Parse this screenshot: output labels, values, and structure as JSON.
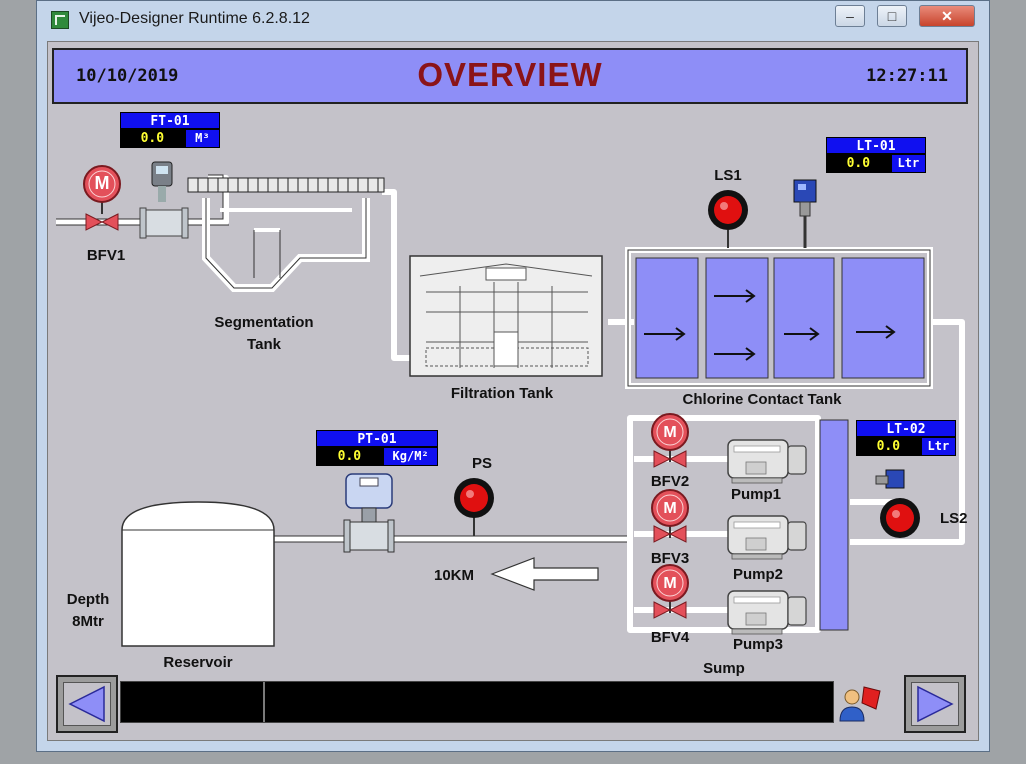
{
  "window": {
    "title": "Vijeo-Designer Runtime 6.2.8.12",
    "min_glyph": "–",
    "max_glyph": "□",
    "close_glyph": "✕"
  },
  "header": {
    "date": "10/10/2019",
    "title": "OVERVIEW",
    "time": "12:27:11"
  },
  "tags": {
    "ft01": {
      "name": "FT-01",
      "value": "0.0",
      "unit": "M³"
    },
    "lt01": {
      "name": "LT-01",
      "value": "0.0",
      "unit": "Ltr"
    },
    "lt02": {
      "name": "LT-02",
      "value": "0.0",
      "unit": "Ltr"
    },
    "pt01": {
      "name": "PT-01",
      "value": "0.0",
      "unit": "Kg/M²"
    }
  },
  "labels": {
    "bfv1": "BFV1",
    "bfv2": "BFV2",
    "bfv3": "BFV3",
    "bfv4": "BFV4",
    "seg_tank_1": "Segmentation",
    "seg_tank_2": "Tank",
    "filtration_tank": "Filtration Tank",
    "chlorine_tank": "Chlorine Contact Tank",
    "ls1": "LS1",
    "ls2": "LS2",
    "ps": "PS",
    "pump1": "Pump1",
    "pump2": "Pump2",
    "pump3": "Pump3",
    "sump": "Sump",
    "distance": "10KM",
    "depth_1": "Depth",
    "depth_2": "8Mtr",
    "reservoir": "Reservoir",
    "motor_letter": "M"
  },
  "colors": {
    "header_bg": "#8e8ef7",
    "title_red": "#8b1418",
    "tag_blue": "#1010f0",
    "tag_value_yellow": "#ffff33",
    "chlorine_fill": "#8e8ef7",
    "valve_red": "#e3505a",
    "sensor_red": "#e01010"
  },
  "icons": {
    "nav_prev": "left-triangle-icon",
    "nav_next": "right-triangle-icon",
    "alarm": "operator-alarm-icon"
  }
}
